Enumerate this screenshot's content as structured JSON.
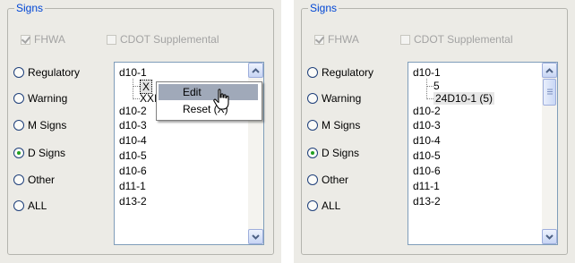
{
  "panels": [
    {
      "group_title": "Signs",
      "checkboxes": [
        {
          "label": "FHWA",
          "checked": true,
          "disabled": true
        },
        {
          "label": "CDOT Supplemental",
          "checked": false,
          "disabled": true
        }
      ],
      "radios": [
        {
          "label": "Regulatory",
          "checked": false
        },
        {
          "label": "Warning",
          "checked": false
        },
        {
          "label": "M Signs",
          "checked": false
        },
        {
          "label": "D Signs",
          "checked": true
        },
        {
          "label": "Other",
          "checked": false
        },
        {
          "label": "ALL",
          "checked": false
        }
      ],
      "list": {
        "items": [
          "d10-1",
          "X",
          "XXI",
          "d10-2",
          "d10-3",
          "d10-4",
          "d10-5",
          "d10-6",
          "d11-1",
          "d13-2"
        ]
      },
      "context_menu": {
        "items": [
          "Edit",
          "Reset (X)"
        ],
        "highlighted": "Edit"
      }
    },
    {
      "group_title": "Signs",
      "checkboxes": [
        {
          "label": "FHWA",
          "checked": true,
          "disabled": true
        },
        {
          "label": "CDOT Supplemental",
          "checked": false,
          "disabled": true
        }
      ],
      "radios": [
        {
          "label": "Regulatory",
          "checked": false
        },
        {
          "label": "Warning",
          "checked": false
        },
        {
          "label": "M Signs",
          "checked": false
        },
        {
          "label": "D Signs",
          "checked": true
        },
        {
          "label": "Other",
          "checked": false
        },
        {
          "label": "ALL",
          "checked": false
        }
      ],
      "list": {
        "items": [
          "d10-1",
          "5",
          "24D10-1 (5)",
          "d10-2",
          "d10-3",
          "d10-4",
          "d10-5",
          "d10-6",
          "d11-1",
          "d13-2"
        ]
      }
    }
  ],
  "icons": {
    "scroll_up": "chevron-up-icon",
    "scroll_down": "chevron-down-icon",
    "cursor": "hand-cursor-icon"
  },
  "colors": {
    "group_title": "#0046d5",
    "disabled_text": "#a3a3a3",
    "radio_dot": "#21a121",
    "menu_highlight": "#a0a9b9"
  }
}
